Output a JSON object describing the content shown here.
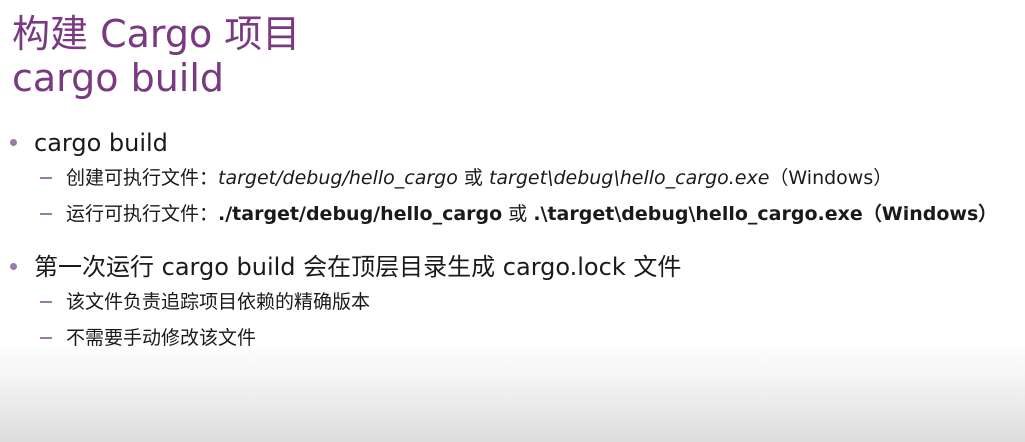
{
  "title": {
    "line1": "构建 Cargo 项目",
    "line2": "cargo build"
  },
  "bullets": [
    {
      "text": "cargo build",
      "sub": [
        {
          "prefix": "创建可执行文件：",
          "path1": "target/debug/hello_cargo",
          "or": " 或 ",
          "path2": "target\\debug\\hello_cargo.exe",
          "suffix": "（Windows）"
        },
        {
          "prefix": "运行可执行文件：",
          "path1": "./target/debug/hello_cargo",
          "or": " 或 ",
          "path2": ".\\target\\debug\\hello_cargo.exe",
          "suffix": "（Windows）"
        }
      ]
    },
    {
      "text": "第一次运行 cargo build 会在顶层目录生成 cargo.lock 文件",
      "sub": [
        {
          "text": "该文件负责追踪项目依赖的精确版本"
        },
        {
          "text": "不需要手动修改该文件"
        }
      ]
    }
  ],
  "colors": {
    "title": "#7a3a82",
    "bullet_marker": "#9a7aa6",
    "text": "#1a1a1a"
  }
}
